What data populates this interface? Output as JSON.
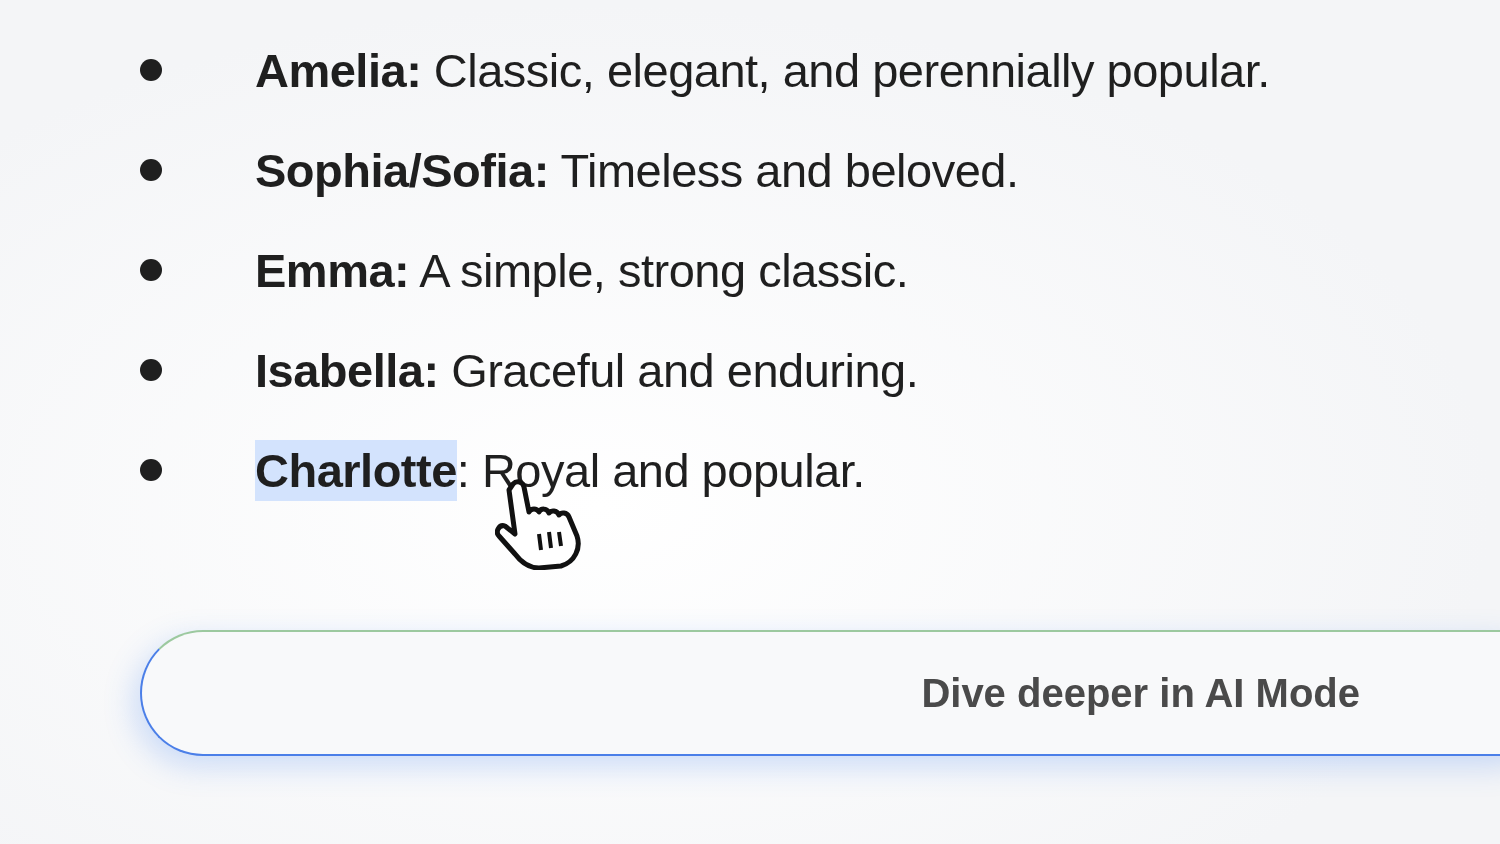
{
  "list": [
    {
      "name": "Amelia:",
      "rest": " Classic, elegant, and perennially popular.",
      "highlighted": false
    },
    {
      "name": "Sophia/Sofia:",
      "rest": " Timeless and beloved.",
      "highlighted": false
    },
    {
      "name": "Emma:",
      "rest": " A simple, strong classic.",
      "highlighted": false
    },
    {
      "name": "Isabella:",
      "rest": " Graceful and enduring.",
      "highlighted": false
    },
    {
      "name": "Charlotte",
      "rest": ": Royal and popular.",
      "highlighted": true
    }
  ],
  "ai_button": {
    "label": "Dive deeper in AI Mode"
  }
}
